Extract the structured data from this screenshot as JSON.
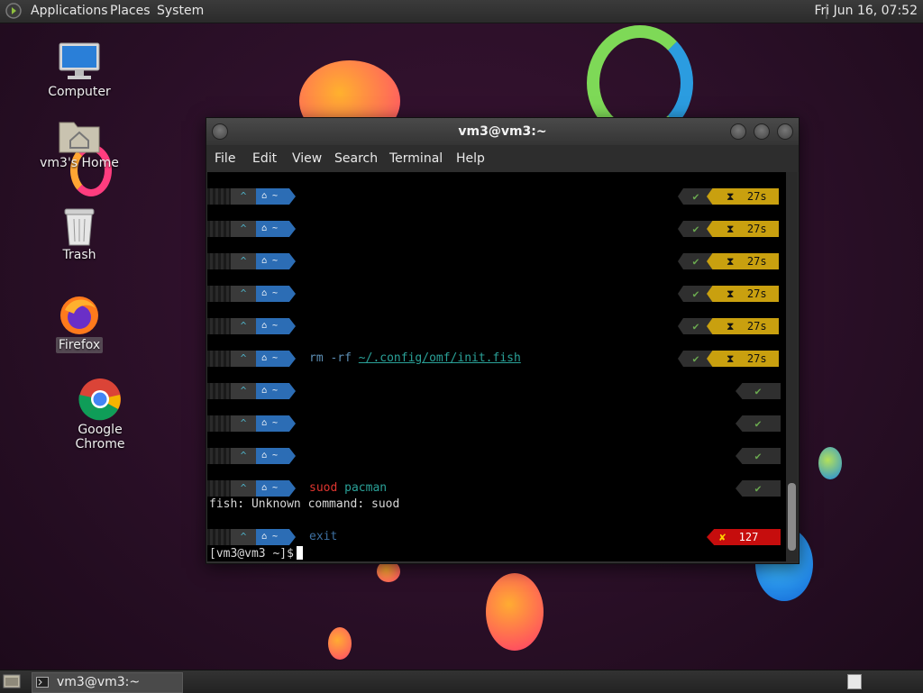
{
  "top_panel": {
    "menus": [
      "Applications",
      "Places",
      "System"
    ],
    "clock": "Fri Jun 16, 07:52"
  },
  "desktop": {
    "icons": [
      {
        "label": "Computer",
        "icon": "computer-icon"
      },
      {
        "label": "vm3's Home",
        "icon": "home-folder-icon"
      },
      {
        "label": "Trash",
        "icon": "trash-icon"
      },
      {
        "label": "Firefox",
        "icon": "firefox-icon"
      },
      {
        "label": "Google Chrome",
        "icon": "chrome-icon"
      }
    ]
  },
  "terminal": {
    "title": "vm3@vm3:~",
    "menu": [
      "File",
      "Edit",
      "View",
      "Search",
      "Terminal",
      "Help"
    ],
    "prompt_arrow": "^",
    "prompt_home": "~",
    "rows": [
      {
        "cmd": "",
        "status": "ok",
        "time": "27s"
      },
      {
        "cmd": "",
        "status": "ok",
        "time": "27s"
      },
      {
        "cmd": "",
        "status": "ok",
        "time": "27s"
      },
      {
        "cmd": "",
        "status": "ok",
        "time": "27s"
      },
      {
        "cmd": "",
        "status": "ok",
        "time": "27s"
      },
      {
        "cmd1": "rm -rf",
        "cmd2": "~/.config/omf/init.fish",
        "status": "ok",
        "time": "27s"
      },
      {
        "cmd": "",
        "status": "ok"
      },
      {
        "cmd": "",
        "status": "ok"
      },
      {
        "cmd": "",
        "status": "ok"
      },
      {
        "cmd1": "suod",
        "cmd2": "pacman",
        "status": "ok"
      },
      {
        "cmd": "exit",
        "status": "error",
        "code": "127"
      }
    ],
    "error_line": "fish: Unknown command: suod",
    "final_prompt": "[vm3@vm3 ~]$",
    "ok_glyph": "✔",
    "err_glyph": "✘",
    "time_glyph": "⧗"
  },
  "taskbar": {
    "task_label": "vm3@vm3:~"
  },
  "colors": {
    "prompt_blue": "#2c6db5",
    "time_yellow": "#c9a00f",
    "error_red": "#c60d0d",
    "ok_green": "#6aa84f",
    "cmd_error": "#e0352f",
    "cmd_arg": "#2aa198",
    "path_cyan": "#4fb3c8"
  }
}
